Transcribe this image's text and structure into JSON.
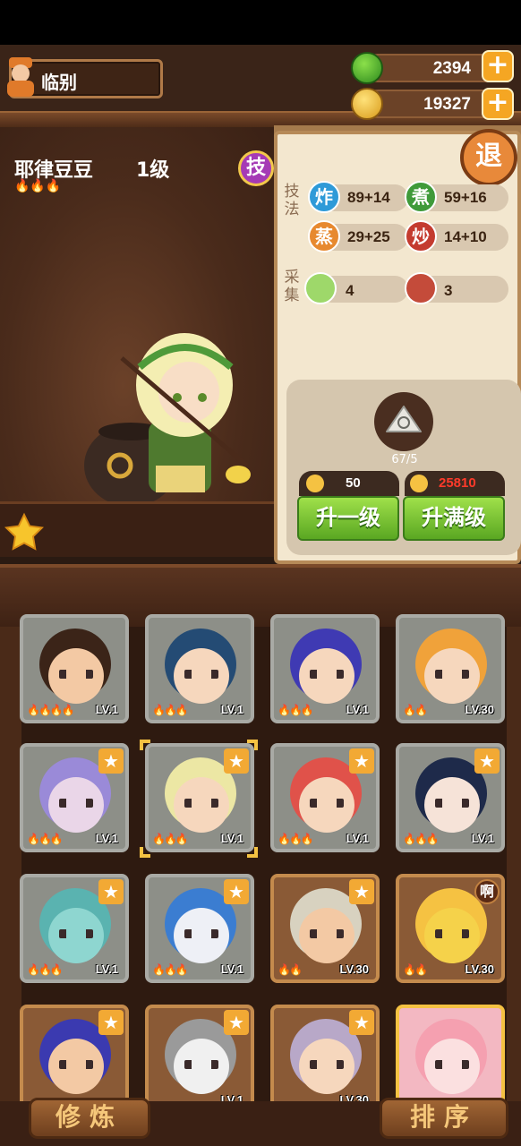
{
  "location": {
    "label": "临别"
  },
  "resources": [
    {
      "name": "jade",
      "value": "2394",
      "icon": "green-jade-icon"
    },
    {
      "name": "coins",
      "value": "19327",
      "icon": "gold-coin-icon"
    }
  ],
  "character": {
    "name": "耶律豆豆",
    "level": "1级",
    "flames": "🔥🔥🔥",
    "skill_label": "技"
  },
  "panel": {
    "exit_label": "退",
    "skills_label": "技法",
    "gather_label": "采集",
    "skills": [
      {
        "icon_text": "炸",
        "value": "89+14",
        "color": "#2e9ad8"
      },
      {
        "icon_text": "煮",
        "value": "59+16",
        "color": "#3f9a3a"
      },
      {
        "icon_text": "蒸",
        "value": "29+25",
        "color": "#e7892f"
      },
      {
        "icon_text": "炒",
        "value": "14+10",
        "color": "#c43b2f"
      }
    ],
    "gather": [
      {
        "icon": "cabbage-icon",
        "value": "4"
      },
      {
        "icon": "meat-icon",
        "value": "3"
      }
    ],
    "material_count": "67/5",
    "costs": [
      {
        "value": "50",
        "color": "#ffffff"
      },
      {
        "value": "25810",
        "color": "#ff3a2a"
      }
    ],
    "upgrade_one_label": "升一级",
    "upgrade_max_label": "升满级"
  },
  "cards": [
    {
      "lv": "LV.1",
      "flames": "🔥🔥🔥🔥",
      "star": false,
      "border": "silver",
      "bg": "#8d8f88",
      "face": "#f3c9a4",
      "hair": "#3b2418"
    },
    {
      "lv": "LV.1",
      "flames": "🔥🔥🔥",
      "star": false,
      "border": "silver",
      "bg": "#8d8f88",
      "face": "#f6d7bd",
      "hair": "#244b74"
    },
    {
      "lv": "LV.1",
      "flames": "🔥🔥🔥",
      "star": false,
      "border": "silver",
      "bg": "#8d8f88",
      "face": "#f6d7bd",
      "hair": "#3f3ab3"
    },
    {
      "lv": "LV.30",
      "flames": "🔥🔥",
      "star": false,
      "border": "silver",
      "bg": "#8d8f88",
      "face": "#f6d7bd",
      "hair": "#f0a23a"
    },
    {
      "lv": "LV.1",
      "flames": "🔥🔥🔥",
      "star": true,
      "border": "silver",
      "bg": "#8d8f88",
      "face": "#ead6e8",
      "hair": "#9a8ad8"
    },
    {
      "lv": "LV.1",
      "flames": "🔥🔥🔥",
      "star": true,
      "border": "silver",
      "bg": "#8d8f88",
      "face": "#f6d7bd",
      "hair": "#ece7a4"
    },
    {
      "lv": "LV.1",
      "flames": "🔥🔥🔥",
      "star": true,
      "border": "silver",
      "bg": "#8d8f88",
      "face": "#f6d7bd",
      "hair": "#e0524a"
    },
    {
      "lv": "LV.1",
      "flames": "🔥🔥🔥",
      "star": true,
      "border": "silver",
      "bg": "#8d8f88",
      "face": "#f6e3d8",
      "hair": "#1e2a4a"
    },
    {
      "lv": "LV.1",
      "flames": "🔥🔥🔥",
      "star": true,
      "border": "silver",
      "bg": "#8d8f88",
      "face": "#8ed6d0",
      "hair": "#5ab3b0"
    },
    {
      "lv": "LV.1",
      "flames": "🔥🔥🔥",
      "star": true,
      "border": "silver",
      "bg": "#8d8f88",
      "face": "#eef0f6",
      "hair": "#3b7dd1"
    },
    {
      "lv": "LV.30",
      "flames": "🔥🔥",
      "star": true,
      "border": "gold",
      "bg": "#8a5a36",
      "face": "#f3c9a4",
      "hair": "#d8d2c0"
    },
    {
      "lv": "LV.30",
      "flames": "🔥🔥",
      "star": false,
      "border": "gold",
      "bg": "#8a5a36",
      "face": "#f5d24a",
      "hair": "#f5c242",
      "badge": "啊"
    },
    {
      "lv": "",
      "flames": "",
      "star": true,
      "border": "gold",
      "bg": "#8a5a36",
      "face": "#f3c9a4",
      "hair": "#3b3ab0"
    },
    {
      "lv": "LV.1",
      "flames": "",
      "star": true,
      "border": "gold",
      "bg": "#8a5a36",
      "face": "#f0f0f0",
      "hair": "#9a9a9a"
    },
    {
      "lv": "LV.30",
      "flames": "",
      "star": true,
      "border": "gold",
      "bg": "#8a5a36",
      "face": "#f6d7bd",
      "hair": "#b8a8c8"
    },
    {
      "lv": "",
      "flames": "",
      "star": false,
      "border": "pink",
      "bg": "#f3b8c2",
      "face": "#fbe0e0",
      "hair": "#f5a0b0"
    }
  ],
  "bottom": {
    "train_label": "修炼",
    "sort_label": "排序"
  }
}
